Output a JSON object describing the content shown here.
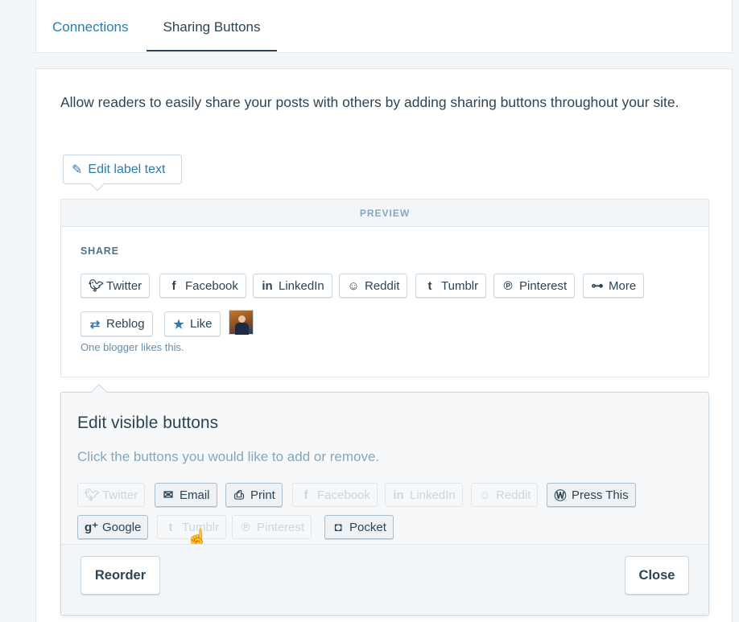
{
  "tabs": [
    {
      "label": "Connections"
    },
    {
      "label": "Sharing Buttons"
    }
  ],
  "intro": "Allow readers to easily share your posts with others by adding sharing buttons throughout your site.",
  "edit_label_text": "Edit label text",
  "preview": {
    "heading": "PREVIEW",
    "share_title": "SHARE",
    "buttons": [
      {
        "label": "Twitter",
        "icon": "twitter-icon"
      },
      {
        "label": "Facebook",
        "icon": "facebook-icon"
      },
      {
        "label": "LinkedIn",
        "icon": "linkedin-icon"
      },
      {
        "label": "Reddit",
        "icon": "reddit-icon"
      },
      {
        "label": "Tumblr",
        "icon": "tumblr-icon"
      },
      {
        "label": "Pinterest",
        "icon": "pinterest-icon"
      },
      {
        "label": "More",
        "icon": "more-icon"
      }
    ],
    "reblog_label": "Reblog",
    "like_label": "Like",
    "likes_text": "One blogger likes this."
  },
  "edit_panel": {
    "title": "Edit visible buttons",
    "subtitle": "Click the buttons you would like to add or remove.",
    "buttons": [
      {
        "label": "Twitter",
        "icon": "twitter-icon",
        "enabled": false
      },
      {
        "label": "Email",
        "icon": "email-icon",
        "enabled": true
      },
      {
        "label": "Print",
        "icon": "print-icon",
        "enabled": true
      },
      {
        "label": "Facebook",
        "icon": "facebook-icon",
        "enabled": false
      },
      {
        "label": "LinkedIn",
        "icon": "linkedin-icon",
        "enabled": false
      },
      {
        "label": "Reddit",
        "icon": "reddit-icon",
        "enabled": false
      },
      {
        "label": "Press This",
        "icon": "wordpress-icon",
        "enabled": true
      },
      {
        "label": "Google",
        "icon": "google-plus-icon",
        "enabled": true
      },
      {
        "label": "Tumblr",
        "icon": "tumblr-icon",
        "enabled": false
      },
      {
        "label": "Pinterest",
        "icon": "pinterest-icon",
        "enabled": false
      },
      {
        "label": "Pocket",
        "icon": "pocket-icon",
        "enabled": true
      }
    ],
    "reorder_label": "Reorder",
    "close_label": "Close"
  },
  "colors": {
    "accent": "#2a7db0",
    "text": "#2e4453",
    "muted": "#87a6bc",
    "border": "#c8d7e1"
  }
}
